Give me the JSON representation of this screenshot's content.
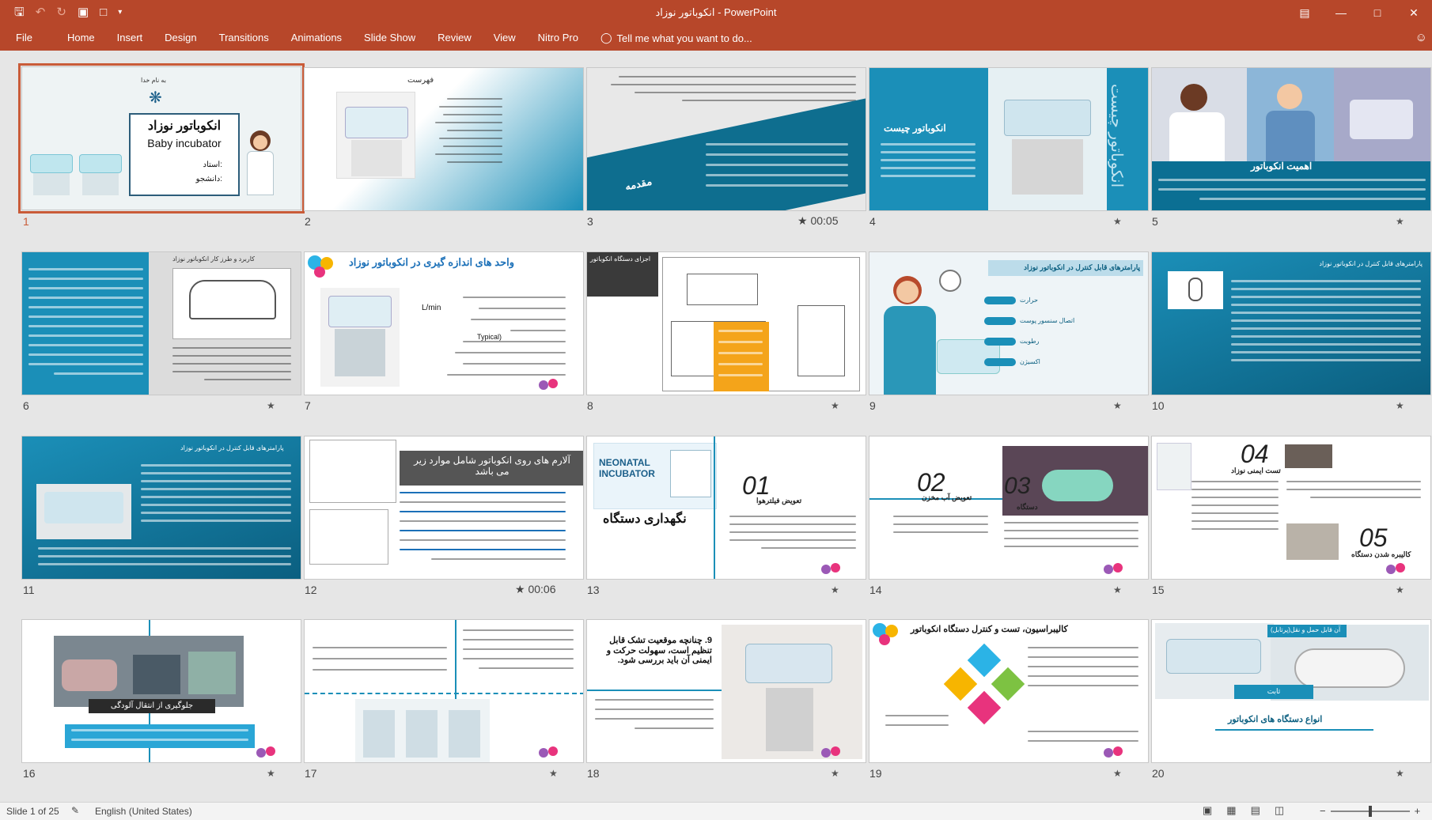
{
  "window": {
    "title": "انکوباتور نوزاد - PowerPoint",
    "qat_icons": [
      "save-icon",
      "undo-icon",
      "redo-icon",
      "present-icon",
      "new-icon",
      "customize-icon"
    ],
    "controls": [
      "restore-ribbon-icon",
      "minimize-icon",
      "maximize-icon",
      "close-icon"
    ]
  },
  "ribbon": {
    "tabs": [
      "File",
      "Home",
      "Insert",
      "Design",
      "Transitions",
      "Animations",
      "Slide Show",
      "Review",
      "View",
      "Nitro Pro"
    ],
    "tell_me": "Tell me what you want to do..."
  },
  "slides": [
    {
      "n": "1",
      "title": "انکوباتور نوزاد",
      "subtitle": "Baby incubator",
      "line1": "استاد:",
      "line2": "دانشجو:",
      "header": "به نام خدا",
      "timing": ""
    },
    {
      "n": "2",
      "title": "فهرست",
      "timing": ""
    },
    {
      "n": "3",
      "title": "مقدمه",
      "timing": "00:05"
    },
    {
      "n": "4",
      "title": "انکوباتور چیست",
      "side": "انکوباتور چیست",
      "timing": ""
    },
    {
      "n": "5",
      "title": "اهمیت انکوباتور",
      "timing": ""
    },
    {
      "n": "6",
      "title": "کاربرد و طرز کار انکوباتور نوزاد",
      "timing": ""
    },
    {
      "n": "7",
      "title": "واحد های اندازه گیری در انکوباتور نوزاد",
      "unit": "L/min",
      "typical": "Typical)",
      "timing": ""
    },
    {
      "n": "8",
      "title": "اجزای دستگاه انکوباتور",
      "timing": ""
    },
    {
      "n": "9",
      "title": "پارامترهای قابل کنترل در انکوباتور نوزاد",
      "items": [
        "حرارت",
        "اتصال سنسور پوست",
        "رطوبت",
        "اکسیژن"
      ],
      "timing": ""
    },
    {
      "n": "10",
      "title": "پارامترهای قابل کنترل در انکوباتور نوزاد",
      "timing": ""
    },
    {
      "n": "11",
      "title": "پارامترهای قابل کنترل در انکوباتور نوزاد",
      "timing": ""
    },
    {
      "n": "12",
      "title": "آلارم های روی انکوباتور شامل موارد زیر می باشد",
      "timing": "00:06"
    },
    {
      "n": "13",
      "title": "NEONATAL INCUBATOR",
      "subtitle": "نگهداری دستگاه",
      "step": "01",
      "step_title": "تعویض فیلترهوا",
      "timing": ""
    },
    {
      "n": "14",
      "step": "02",
      "step_title": "تعویض آب مخزن",
      "step2": "03",
      "step2_title": "دستگاه",
      "timing": ""
    },
    {
      "n": "15",
      "step": "04",
      "step_title": "تست ایمنی نوزاد",
      "step2": "05",
      "step2_title": "کالیبره شدن دستگاه",
      "timing": ""
    },
    {
      "n": "16",
      "title": "جلوگیری از انتقال آلودگی",
      "timing": ""
    },
    {
      "n": "17",
      "timing": ""
    },
    {
      "n": "18",
      "title": "9. چنانچه موقعیت تشک قابل تنظیم است، سهولت حرکت و ایمنی آن باید بررسی شود.",
      "timing": ""
    },
    {
      "n": "19",
      "title": "کالیبراسیون، تست و کنترل دستگاه انکوباتور",
      "timing": ""
    },
    {
      "n": "20",
      "title": "انواع دستگاه های انکوباتور",
      "label1": "ثابت",
      "label2": "آن قابل حمل و نقل(پرتابل)",
      "timing": ""
    }
  ],
  "status": {
    "slide_info": "Slide 1 of 25",
    "language": "English (United States)"
  },
  "colors": {
    "accent": "#b7472a",
    "teal": "#1b8fb8",
    "dark_teal": "#0b6f93",
    "selection": "#c95b38"
  }
}
